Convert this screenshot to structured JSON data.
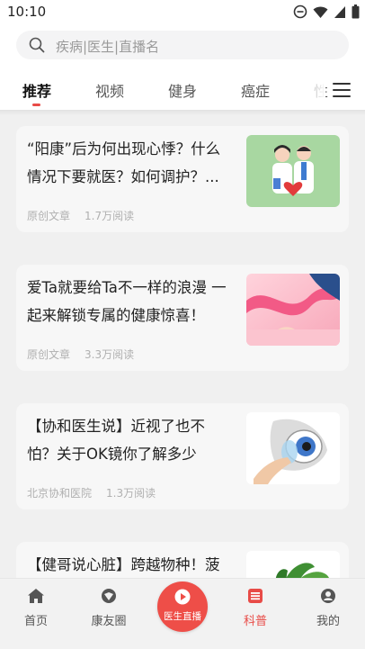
{
  "status_bar": {
    "time": "10:10",
    "icons": [
      "do-not-disturb-icon",
      "wifi-icon",
      "signal-icon",
      "battery-icon"
    ]
  },
  "search": {
    "placeholder": "疾病|医生|直播名",
    "icon": "search-icon"
  },
  "tabs": {
    "items": [
      "推荐",
      "视频",
      "健身",
      "癌症",
      "性"
    ],
    "active_index": 0,
    "menu_icon": "menu-icon"
  },
  "articles": [
    {
      "title": "“阳康”后为何出现心悸？什么情况下要就医？如何调护？...",
      "source": "原创文章",
      "reads": "1.7万阅读",
      "thumb": "doctors-heart-illustration"
    },
    {
      "title": "爱Ta就要给Ta不一样的浪漫 一起来解锁专属的健康惊喜！",
      "source": "原创文章",
      "reads": "3.3万阅读",
      "thumb": "pink-ribbon-hands-image"
    },
    {
      "title": "【协和医生说】近视了也不怕？关于OK镜你了解多少",
      "source": "北京协和医院",
      "reads": "1.3万阅读",
      "thumb": "eye-contact-lens-image"
    },
    {
      "title": "【健哥说心脏】跨越物种！菠",
      "source": "",
      "reads": "",
      "thumb": "green-herb-image"
    }
  ],
  "bottom_nav": {
    "items": [
      {
        "label": "首页",
        "icon": "home-icon"
      },
      {
        "label": "康友圈",
        "icon": "community-icon"
      },
      {
        "label": "医生直播",
        "icon": "play-icon"
      },
      {
        "label": "科普",
        "icon": "article-list-icon"
      },
      {
        "label": "我的",
        "icon": "profile-icon"
      }
    ],
    "active_index": 3
  },
  "colors": {
    "accent": "#e84b47",
    "feed_background": "#f0f0f0",
    "card_background": "#f7f7f7"
  }
}
